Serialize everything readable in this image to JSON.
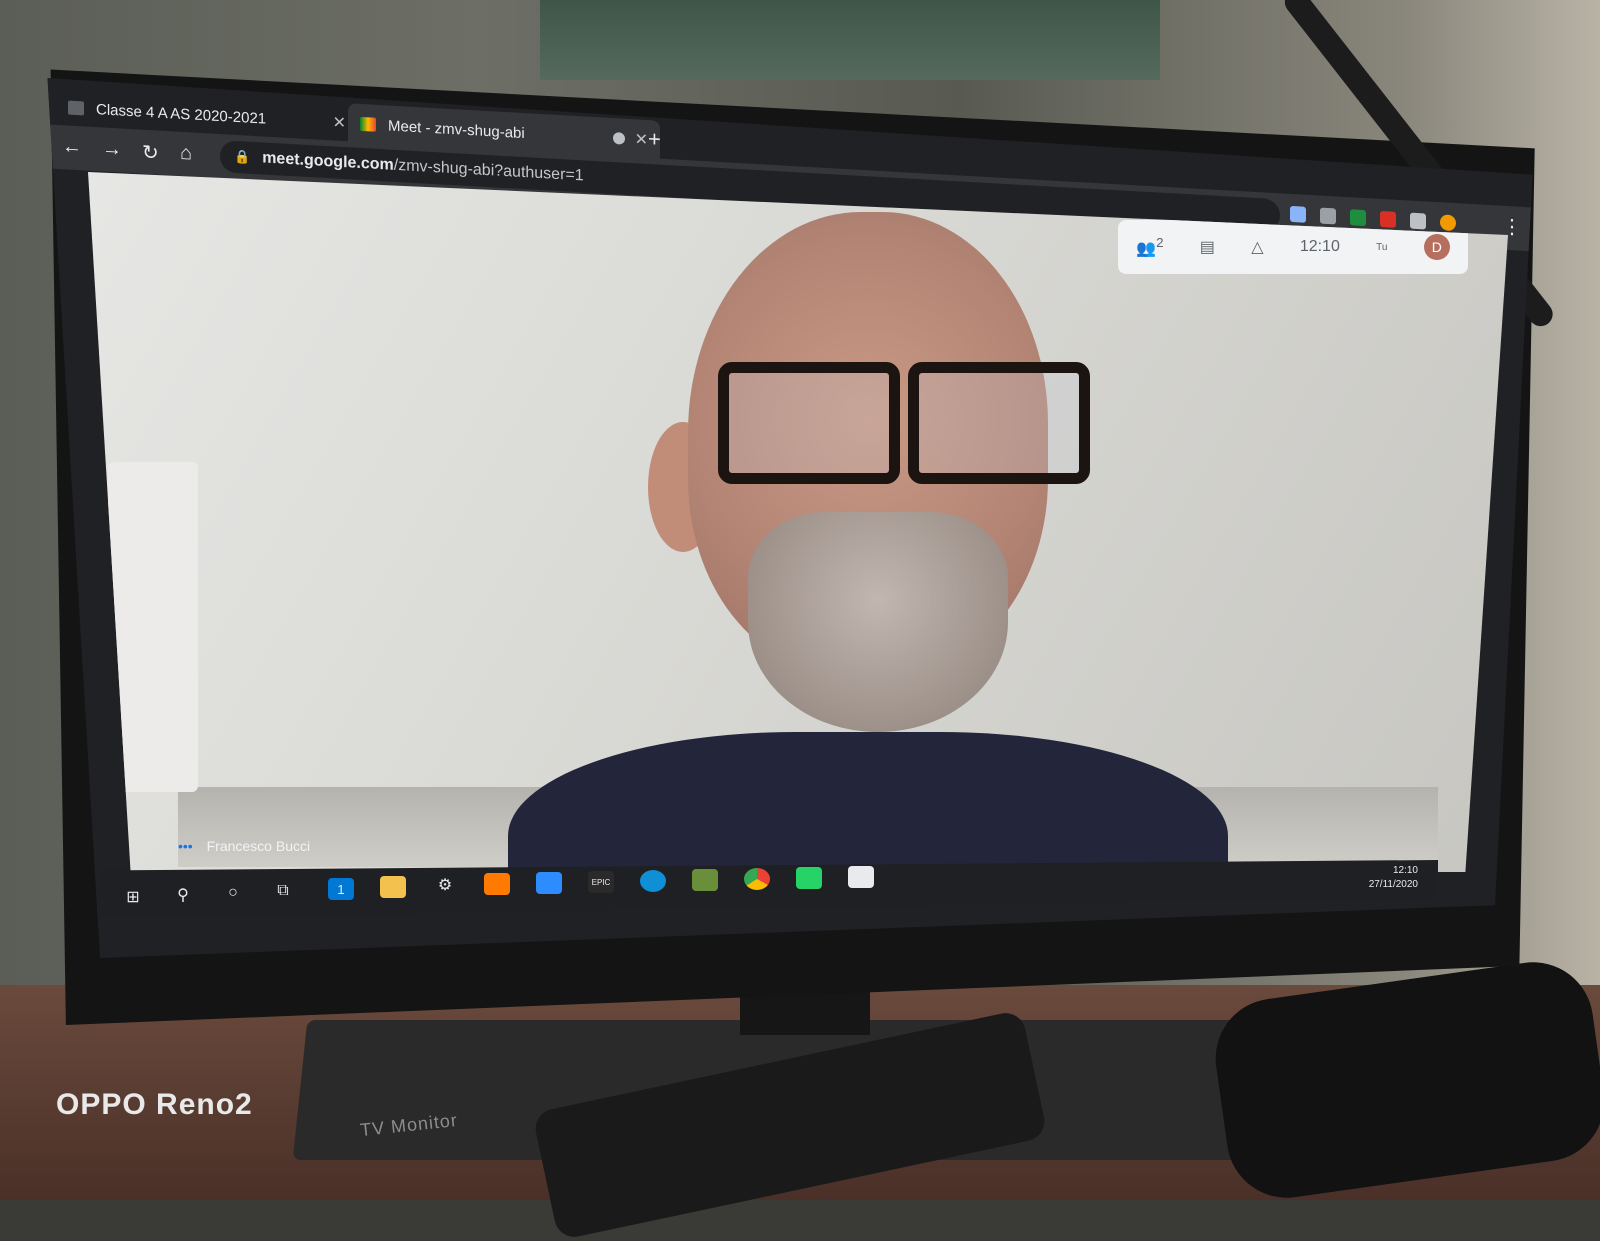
{
  "browser": {
    "tabs": [
      {
        "label": "Classe 4 A AS 2020-2021",
        "icon": "classroom-icon",
        "active": false
      },
      {
        "label": "Meet - zmv-shug-abi",
        "icon": "meet-icon",
        "active": true
      }
    ],
    "new_tab": "+",
    "url_host": "meet.google.com",
    "url_path": "/zmv-shug-abi?authuser=1"
  },
  "meet": {
    "participant_count": "2",
    "time": "12:10",
    "self_label": "Tu",
    "avatar_initial": "D",
    "participant_name": "Francesco Bucci"
  },
  "taskbar": {
    "mail_badge": "1",
    "epic_label": "EPIC",
    "clock_time": "12:10",
    "clock_date": "27/11/2020"
  },
  "physical": {
    "monitor_label": "TV Monitor",
    "camera_watermark": "OPPO Reno2"
  },
  "colors": {
    "browser_bg": "#202124",
    "meet_blue": "#1a73e8",
    "taskbar_bg": "#1f2024"
  }
}
